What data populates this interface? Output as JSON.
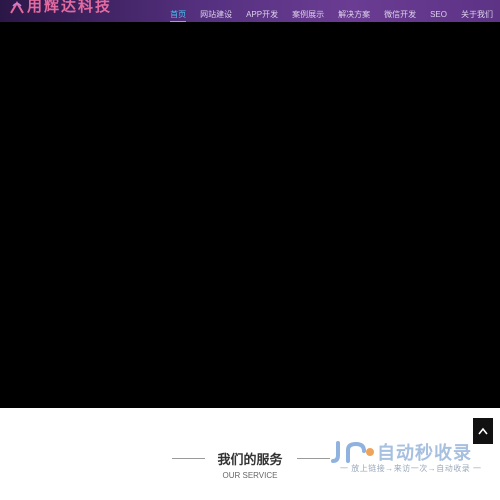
{
  "header": {
    "logo_text": "用辉达科技",
    "nav": [
      {
        "label": "首页",
        "active": true
      },
      {
        "label": "网站建设",
        "active": false
      },
      {
        "label": "APP开发",
        "active": false
      },
      {
        "label": "案例展示",
        "active": false
      },
      {
        "label": "解决方案",
        "active": false
      },
      {
        "label": "微信开发",
        "active": false
      },
      {
        "label": "SEO",
        "active": false
      },
      {
        "label": "关于我们",
        "active": false
      }
    ]
  },
  "service": {
    "title": "我们的服务",
    "subtitle": "OUR SERVICE"
  },
  "back_to_top": {
    "icon": "chevron-up-icon"
  },
  "watermark": {
    "title": "自动秒收录",
    "subtitle": "一 放上链接→来访一次→自动收录 一"
  },
  "colors": {
    "topbar_start": "#2b1747",
    "topbar_end": "#6a3c93",
    "nav_active": "#49c3f2",
    "logo_text": "#e46aa0",
    "hero": "#000000"
  }
}
